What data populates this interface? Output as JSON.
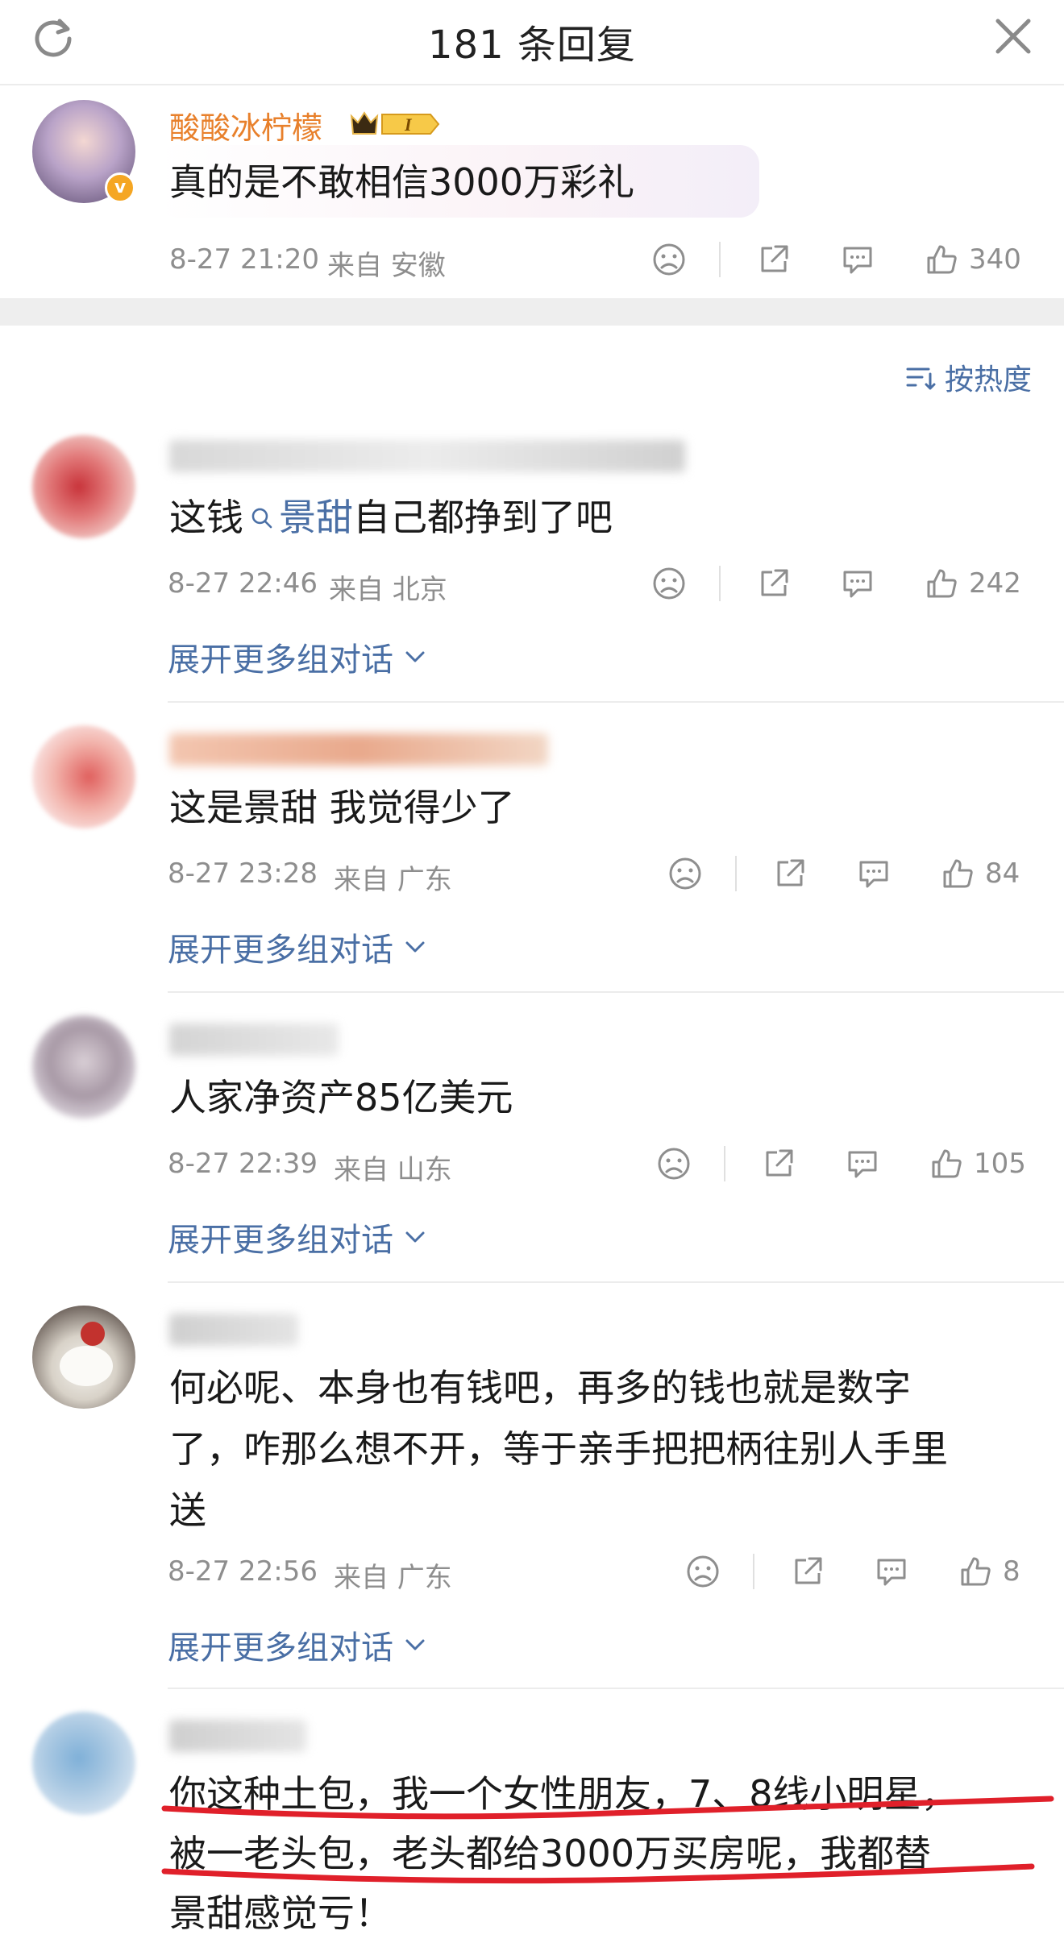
{
  "header": {
    "title": "181 条回复",
    "refresh_icon": "refresh-icon",
    "close_icon": "close-icon"
  },
  "root_comment": {
    "username": "酸酸冰柠檬",
    "text": "真的是不敢相信3000万彩礼",
    "time": "8-27 21:20",
    "location": "来自 安徽",
    "likes": "340"
  },
  "sort": {
    "label": "按热度"
  },
  "expand_label": "展开更多组对话",
  "replies": [
    {
      "username": "",
      "text_before": "这钱",
      "topic": "景甜",
      "text_after": "自己都挣到了吧",
      "time": "8-27 22:46",
      "location": "来自 北京",
      "likes": "242"
    },
    {
      "username": "",
      "text": "这是景甜 我觉得少了",
      "time": "8-27 23:28",
      "location": "来自 广东",
      "likes": "84"
    },
    {
      "username": "",
      "text": "人家净资产85亿美元",
      "time": "8-27 22:39",
      "location": "来自 山东",
      "likes": "105"
    },
    {
      "username": "",
      "text_line1": "何必呢、本身也有钱吧，再多的钱也就是数字",
      "text_line2": "了，咋那么想不开，等于亲手把把柄往别人手里",
      "text_line3": "送",
      "time": "8-27 22:56",
      "location": "来自 广东",
      "likes": "8"
    },
    {
      "username": "",
      "text_line1": "你这种土包，我一个女性朋友，7、8线小明星，",
      "text_line2": "被一老头包，老头都给3000万买房呢，我都替",
      "text_line3": "景甜感觉亏！"
    }
  ],
  "colors": {
    "username": "#e8802b",
    "link": "#4a6fa5",
    "meta": "#8e8e8e",
    "annotation": "#e0202a"
  }
}
